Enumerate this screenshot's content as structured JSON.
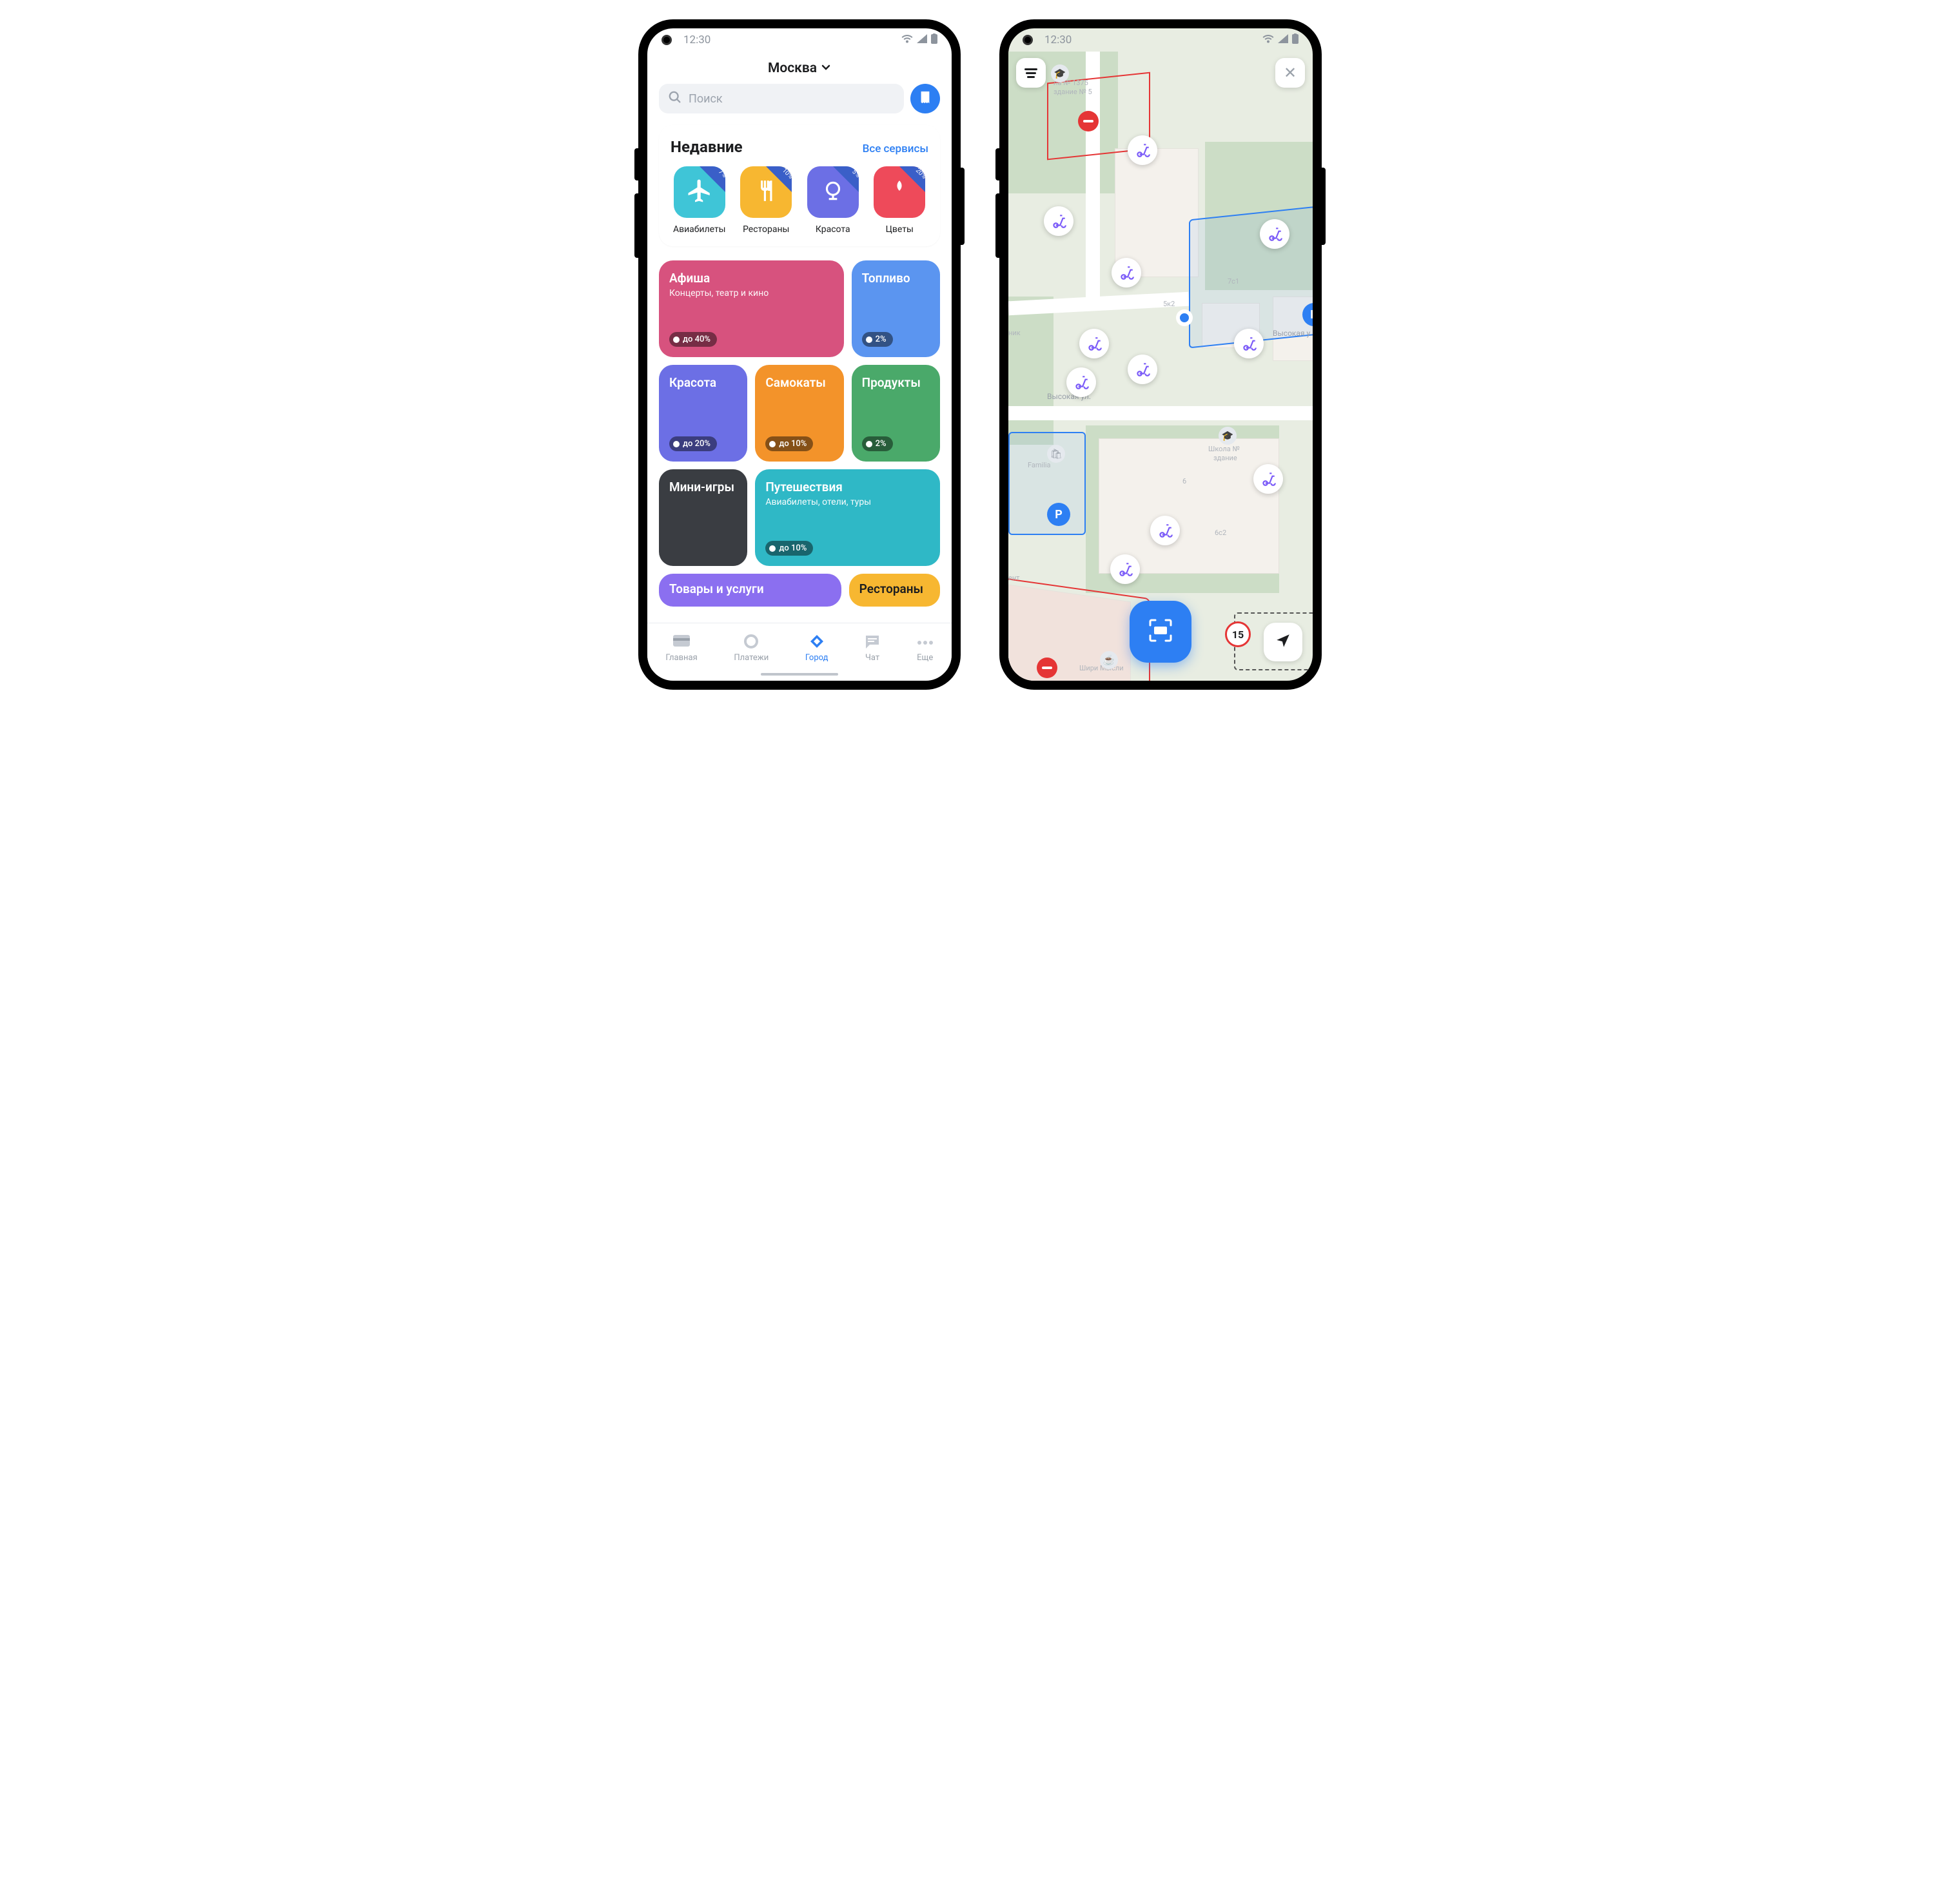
{
  "status": {
    "time": "12:30"
  },
  "screen1": {
    "city": "Москва",
    "search_placeholder": "Поиск",
    "recent": {
      "title": "Недавние",
      "all": "Все сервисы",
      "items": [
        {
          "label": "Авиабилеты",
          "badge": "7%",
          "color": "#3fc5d7"
        },
        {
          "label": "Рестораны",
          "badge": "10%",
          "color": "#f7b731"
        },
        {
          "label": "Красота",
          "badge": "5%",
          "color": "#6c6fe5"
        },
        {
          "label": "Цветы",
          "badge": "20%",
          "color": "#ee4a5a"
        }
      ]
    },
    "categories": [
      {
        "title": "Афиша",
        "subtitle": "Концерты, театр и кино",
        "badge": "до 40%",
        "color": "#d7527e",
        "span": 2
      },
      {
        "title": "Топливо",
        "badge": "2%",
        "color": "#5b95f0",
        "span": 1
      },
      {
        "title": "Красота",
        "badge": "до 20%",
        "color": "#6c6fe5",
        "span": 1
      },
      {
        "title": "Самокаты",
        "badge": "до 10%",
        "color": "#f3932a",
        "span": 1
      },
      {
        "title": "Продукты",
        "badge": "2%",
        "color": "#4aa96a",
        "span": 1
      },
      {
        "title": "Мини-игры",
        "color": "#3a3d42",
        "span": 1
      },
      {
        "title": "Путешествия",
        "subtitle": "Авиабилеты, отели, туры",
        "badge": "до 10%",
        "color": "#2fb8c6",
        "span": 2
      }
    ],
    "peek": [
      {
        "title": "Товары и услуги",
        "color": "#8b6ff0"
      },
      {
        "title": "Рестораны",
        "color": "#f7b731"
      }
    ],
    "tabs": [
      {
        "label": "Главная"
      },
      {
        "label": "Платежи"
      },
      {
        "label": "Город",
        "active": true
      },
      {
        "label": "Чат"
      },
      {
        "label": "Еще"
      }
    ]
  },
  "screen2": {
    "speed_limit": "15",
    "streets": {
      "high": "Высокая ул.",
      "high2": "Высокая у"
    },
    "labels": {
      "school_top": "ла № 1375",
      "school_top_b": "здание № 5",
      "school_mid": "Школа №",
      "school_mid_b": "здание",
      "zdanie6": "6",
      "zdanie7c1": "7с1",
      "zdanie5k2": "5к2",
      "zdanie6c2": "6с2",
      "familia": "Familia",
      "nik": "ник",
      "ent": "ент",
      "shiri": "Шири Мысли"
    }
  }
}
